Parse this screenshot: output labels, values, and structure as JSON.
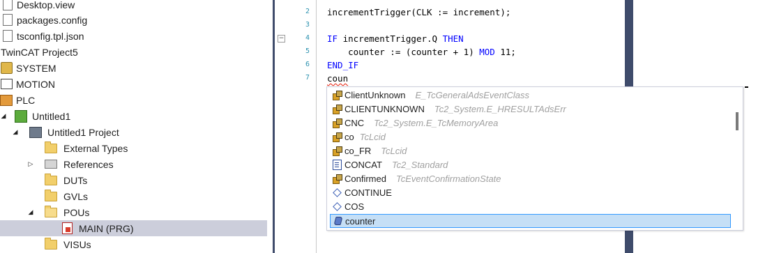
{
  "tree": {
    "items": [
      {
        "label": "Desktop.view",
        "icon": "file-icon"
      },
      {
        "label": "packages.config",
        "icon": "config-file-icon"
      },
      {
        "label": "tsconfig.tpl.json",
        "icon": "json-file-icon"
      },
      {
        "label": "TwinCAT Project5",
        "icon": ""
      },
      {
        "label": "SYSTEM",
        "icon": "system-icon"
      },
      {
        "label": "MOTION",
        "icon": "motion-icon"
      },
      {
        "label": "PLC",
        "icon": "plc-icon"
      },
      {
        "label": "Untitled1",
        "icon": "plc-project-icon"
      },
      {
        "label": "Untitled1 Project",
        "icon": "project-icon"
      },
      {
        "label": "External Types",
        "icon": "folder-icon"
      },
      {
        "label": "References",
        "icon": "references-icon"
      },
      {
        "label": "DUTs",
        "icon": "folder-icon"
      },
      {
        "label": "GVLs",
        "icon": "folder-icon"
      },
      {
        "label": "POUs",
        "icon": "folder-open-icon"
      },
      {
        "label": "MAIN (PRG)",
        "icon": "program-icon"
      },
      {
        "label": "VISUs",
        "icon": "folder-icon"
      }
    ]
  },
  "editor": {
    "line_numbers": [
      "2",
      "3",
      "4",
      "5",
      "6",
      "7"
    ],
    "lines": {
      "l2": "incrementTrigger(CLK := increment);",
      "l4_kw1": "IF",
      "l4_mid": " incrementTrigger.Q ",
      "l4_kw2": "THEN",
      "l5_pre": "    counter := (counter + 1) ",
      "l5_kw": "MOD",
      "l5_post": " 11;",
      "l6_kw": "END_IF",
      "l7": "coun"
    },
    "fold_symbol": "−"
  },
  "autocomplete": {
    "items": [
      {
        "name": "ClientUnknown",
        "type": "E_TcGeneralAdsEventClass",
        "icon": "enum-icon"
      },
      {
        "name": "CLIENTUNKNOWN",
        "type": "Tc2_System.E_HRESULTAdsErr",
        "icon": "enum-icon"
      },
      {
        "name": "CNC",
        "type": "Tc2_System.E_TcMemoryArea",
        "icon": "enum-icon"
      },
      {
        "name": "co",
        "type": "TcLcid",
        "icon": "enum-icon"
      },
      {
        "name": "co_FR",
        "type": "TcLcid",
        "icon": "enum-icon"
      },
      {
        "name": "CONCAT",
        "type": "Tc2_Standard",
        "icon": "function-icon"
      },
      {
        "name": "Confirmed",
        "type": "TcEventConfirmationState",
        "icon": "enum-icon"
      },
      {
        "name": "CONTINUE",
        "type": "",
        "icon": "keyword-icon"
      },
      {
        "name": "COS",
        "type": "",
        "icon": "keyword-icon"
      },
      {
        "name": "counter",
        "type": "",
        "icon": "variable-icon"
      }
    ],
    "selected": "counter"
  },
  "colors": {
    "keyword": "#0000ff",
    "line_number": "#2b91af",
    "selection": "#c5dff6",
    "splitter": "#3f4c6b"
  }
}
